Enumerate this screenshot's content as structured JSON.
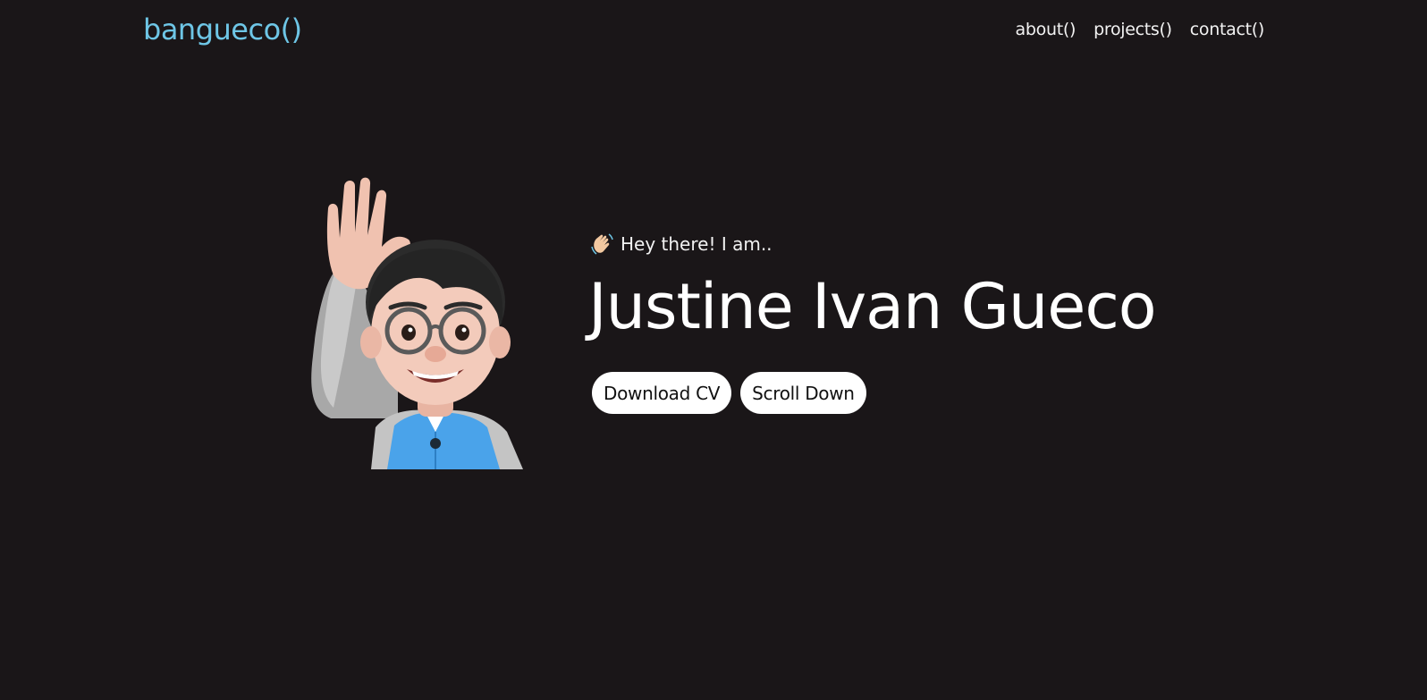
{
  "brand": {
    "label": "bangueco()"
  },
  "nav": {
    "about": "about()",
    "projects": "projects()",
    "contact": "contact()"
  },
  "hero": {
    "greeting": "Hey there! I am..",
    "name": "Justine Ivan Gueco",
    "download_label": "Download CV",
    "scroll_label": "Scroll Down"
  },
  "icons": {
    "greeting_icon": "waving-hand-icon",
    "avatar": "memoji-waving-avatar"
  },
  "colors": {
    "background": "#1a1618",
    "brand": "#6ec6e6",
    "text": "#f2f2f2",
    "button_bg": "#ffffff"
  }
}
